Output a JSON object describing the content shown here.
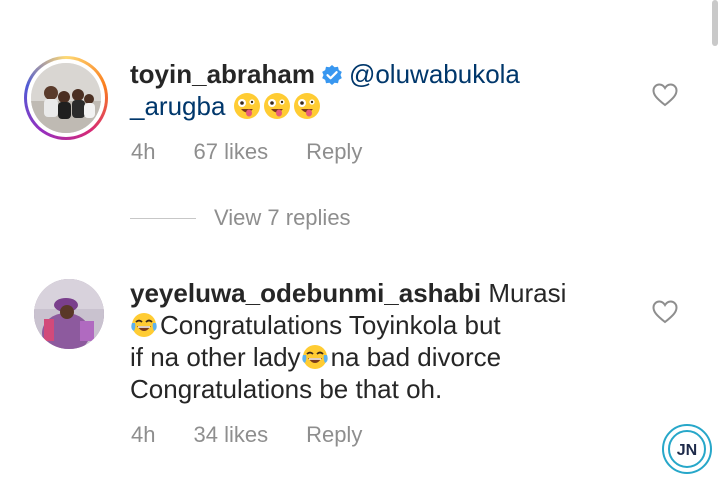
{
  "comments": [
    {
      "username": "toyin_abraham",
      "verified": true,
      "mention_line1": "@oluwabukola",
      "mention_line2": "_arugba",
      "emoji": "crazy-face-emoji",
      "time": "4h",
      "likes": "67 likes",
      "reply": "Reply"
    },
    {
      "username": "yeyeluwa_odebunmi_ashabi",
      "text_line1_rest": "Murasi",
      "text_line2": "Congratulations Toyinkola but",
      "text_line3a": "if na other lady",
      "text_line3b": "na bad divorce",
      "text_line4": "Congratulations be that oh.",
      "emoji": "tears-of-joy-emoji",
      "time": "4h",
      "likes": "34 likes",
      "reply": "Reply"
    }
  ],
  "view_replies": "View 7 replies",
  "colors": {
    "mention": "#00376b",
    "meta": "#8e8e8e",
    "verified": "#3897f0",
    "watermark": "#27a7c9"
  },
  "watermark_text": "JN"
}
